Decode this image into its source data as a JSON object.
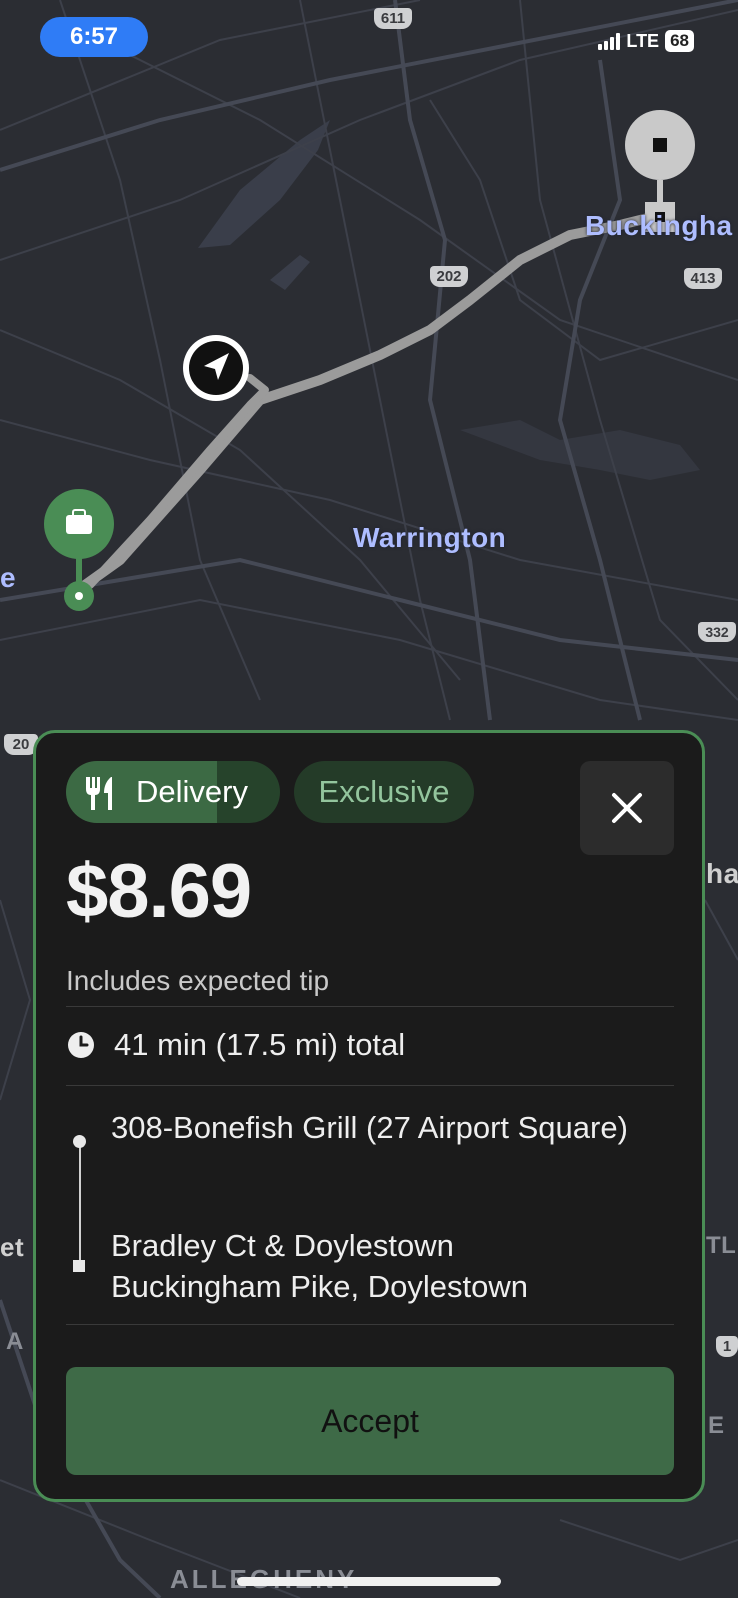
{
  "status_bar": {
    "time": "6:57",
    "network": "LTE",
    "battery": "68"
  },
  "map": {
    "labels": [
      "Warrington",
      "Buckingha",
      "ALLEGHENY"
    ],
    "route_shields": [
      "611",
      "202",
      "413",
      "332",
      "20"
    ],
    "edge_fragments": [
      "e",
      "ha",
      "et",
      "A",
      "TL",
      "E",
      "1"
    ],
    "colors": {
      "route": "#9b9b9b",
      "pickup": "#4a8d55",
      "map_bg": "#2b2d33"
    }
  },
  "offer": {
    "type_label": "Delivery",
    "type_icon": "fork-knife-icon",
    "badge": "Exclusive",
    "price": "$8.69",
    "price_note": "Includes expected tip",
    "duration": "41 min (17.5 mi) total",
    "pickup": "308-Bonefish Grill (27 Airport Square)",
    "dropoff": "Bradley Ct & Doylestown Buckingham Pike, Doylestown",
    "accept_label": "Accept",
    "accent_color": "#4a8d55"
  }
}
